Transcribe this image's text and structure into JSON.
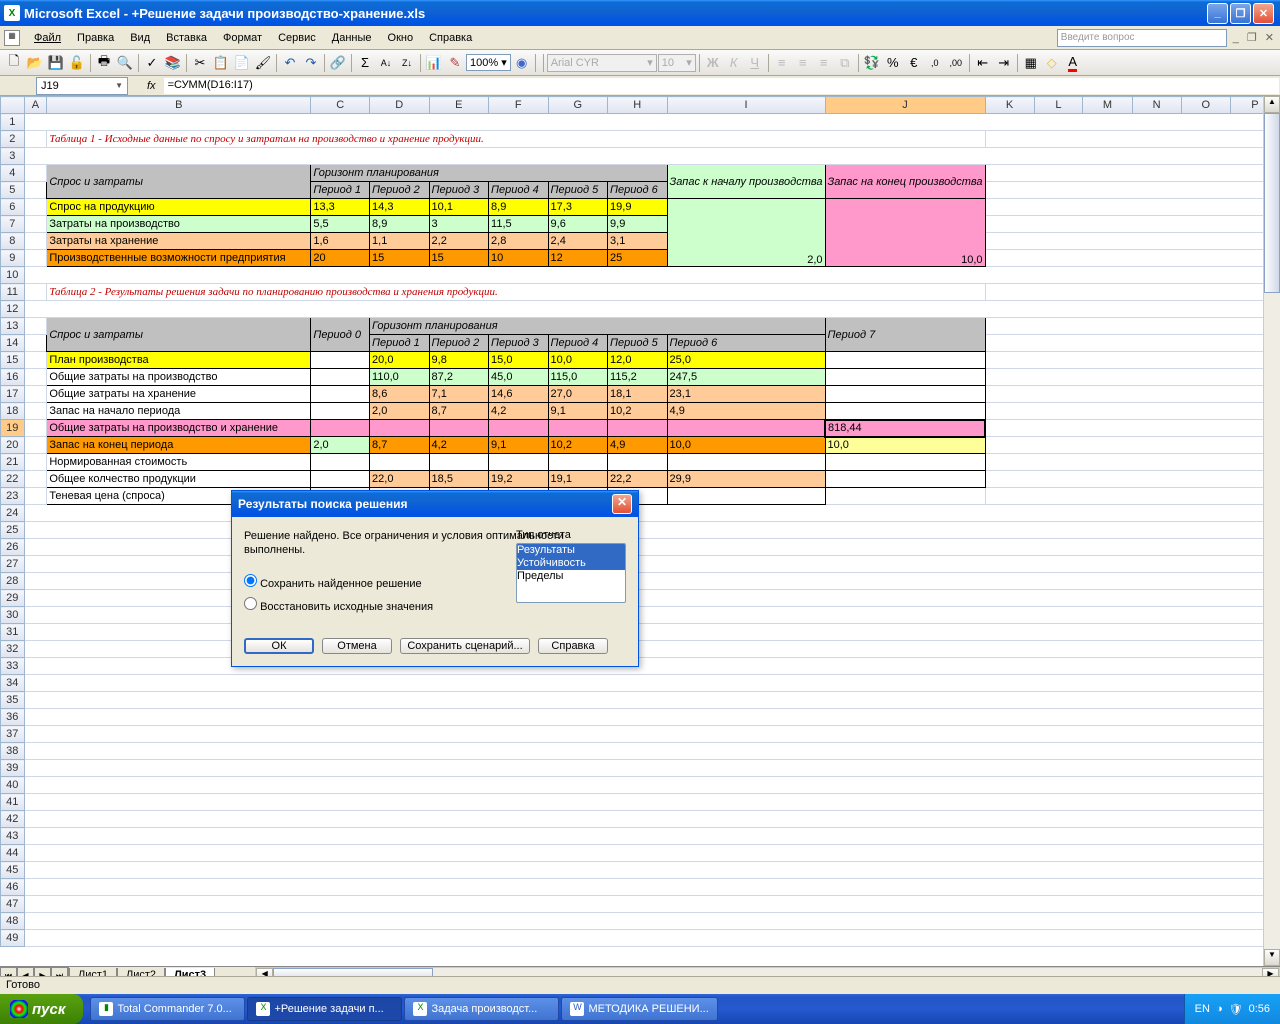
{
  "app": {
    "title": "Microsoft Excel - +Решение задачи производство-хранение.xls"
  },
  "menu": [
    "Файл",
    "Правка",
    "Вид",
    "Вставка",
    "Формат",
    "Сервис",
    "Данные",
    "Окно",
    "Справка"
  ],
  "question_prompt": "Введите вопрос",
  "toolbar": {
    "zoom": "100%",
    "font": "Arial CYR",
    "size": "10"
  },
  "namebox": "J19",
  "formula": "=СУММ(D16:I17)",
  "columns": [
    "",
    "A",
    "B",
    "C",
    "D",
    "E",
    "F",
    "G",
    "H",
    "I",
    "J",
    "K",
    "L",
    "M",
    "N",
    "O",
    "P"
  ],
  "title1": "Таблица 1 - Исходные данные по спросу и затратам на производство и хранение продукции.",
  "title2": "Таблица 2 - Результаты решения задачи по планированию производства и хранения продукции.",
  "t1": {
    "hdr_demand": "Спрос и затраты",
    "hdr_horizon": "Горизонт планирования",
    "hdr_start": "Запас к началу производства",
    "hdr_end": "Запас на конец производства",
    "periods": [
      "Период 1",
      "Период 2",
      "Период 3",
      "Период 4",
      "Период 5",
      "Период 6"
    ],
    "rows": [
      {
        "label": "Спрос на продукцию",
        "vals": [
          "13,3",
          "14,3",
          "10,1",
          "8,9",
          "17,3",
          "19,9"
        ],
        "start": "",
        "end": ""
      },
      {
        "label": "Затраты на производство",
        "vals": [
          "5,5",
          "8,9",
          "3",
          "11,5",
          "9,6",
          "9,9"
        ],
        "start": "",
        "end": ""
      },
      {
        "label": "Затраты на хранение",
        "vals": [
          "1,6",
          "1,1",
          "2,2",
          "2,8",
          "2,4",
          "3,1"
        ],
        "start": "",
        "end": ""
      },
      {
        "label": "Производственные возможности предприятия",
        "vals": [
          "20",
          "15",
          "15",
          "10",
          "12",
          "25"
        ],
        "start": "2,0",
        "end": "10,0"
      }
    ]
  },
  "t2": {
    "hdr_demand": "Спрос и затраты",
    "hdr_horizon": "Горизонт планирования",
    "period0": "Период 0",
    "periods": [
      "Период 1",
      "Период 2",
      "Период 3",
      "Период 4",
      "Период 5",
      "Период 6"
    ],
    "period7": "Период 7",
    "rows": {
      "r15": {
        "label": "План производства",
        "p0": "",
        "vals": [
          "20,0",
          "9,8",
          "15,0",
          "10,0",
          "12,0",
          "25,0"
        ],
        "p7": ""
      },
      "r16": {
        "label": "Общие  затраты на производство",
        "p0": "",
        "vals": [
          "110,0",
          "87,2",
          "45,0",
          "115,0",
          "115,2",
          "247,5"
        ],
        "p7": ""
      },
      "r17": {
        "label": "Общие  затраты на хранение",
        "p0": "",
        "vals": [
          "8,6",
          "7,1",
          "14,6",
          "27,0",
          "18,1",
          "23,1"
        ],
        "p7": ""
      },
      "r18": {
        "label": "Запас на начало периода",
        "p0": "",
        "vals": [
          "2,0",
          "8,7",
          "4,2",
          "9,1",
          "10,2",
          "4,9"
        ],
        "p7": ""
      },
      "r19": {
        "label": "Общие затраты на производство и хранение",
        "p0": "",
        "vals": [
          "",
          "",
          "",
          "",
          "",
          ""
        ],
        "p7": "818,44"
      },
      "r20": {
        "label": "Запас на конец периода",
        "p0": "2,0",
        "vals": [
          "8,7",
          "4,2",
          "9,1",
          "10,2",
          "4,9",
          "10,0"
        ],
        "p7": "10,0"
      },
      "r21": {
        "label": "Нормированная стоимость",
        "p0": "",
        "vals": [
          "",
          "",
          "",
          "",
          "",
          ""
        ],
        "p7": ""
      },
      "r22": {
        "label": "Общее колчество продукции",
        "p0": "",
        "vals": [
          "22,0",
          "18,5",
          "19,2",
          "19,1",
          "22,2",
          "29,9"
        ],
        "p7": ""
      },
      "r23": {
        "label": "Теневая цена (спроса)",
        "p0": "",
        "vals": [
          "",
          "",
          "",
          "",
          "",
          ""
        ],
        "p7": ""
      }
    }
  },
  "sheets": [
    "Лист1",
    "Лист2",
    "Лист3"
  ],
  "status": "Готово",
  "dialog": {
    "title": "Результаты поиска решения",
    "message": "Решение найдено. Все ограничения и условия оптимальности выполнены.",
    "radio1": "Сохранить найденное решение",
    "radio2": "Восстановить исходные значения",
    "report_label": "Тип отчета",
    "reports": [
      "Результаты",
      "Устойчивость",
      "Пределы"
    ],
    "btn_ok": "ОК",
    "btn_cancel": "Отмена",
    "btn_save": "Сохранить сценарий...",
    "btn_help": "Справка"
  },
  "taskbar": {
    "start": "пуск",
    "tasks": [
      "Total Commander 7.0...",
      "+Решение задачи п...",
      "Задача производст...",
      "МЕТОДИКА РЕШЕНИ..."
    ],
    "lang": "EN",
    "time": "0:56"
  }
}
